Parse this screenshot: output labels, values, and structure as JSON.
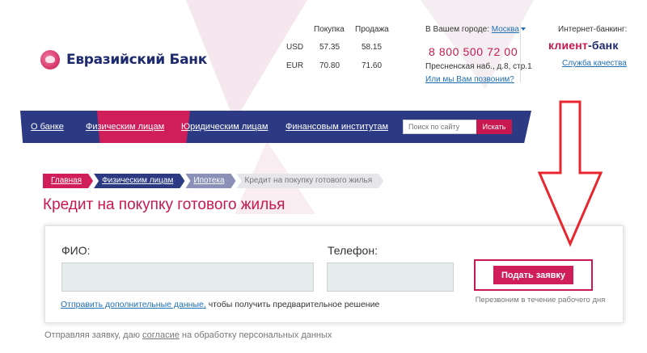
{
  "logo": {
    "name": "Евразийский Банк"
  },
  "rates": {
    "buy_header": "Покупка",
    "sell_header": "Продажа",
    "rows": [
      {
        "currency": "USD",
        "buy": "57.35",
        "sell": "58.15"
      },
      {
        "currency": "EUR",
        "buy": "70.80",
        "sell": "71.60"
      }
    ]
  },
  "contacts": {
    "city_label": "В Вашем городе:",
    "city_value": "Москва",
    "phone": "8 800 500 72 00",
    "address": "Пресненская наб., д.8, стр.1",
    "callback_link": "Или мы Вам позвоним?"
  },
  "internet_banking": {
    "title": "Интернет-банкинг:",
    "brand_part1": "клиент",
    "brand_part2": "-банк",
    "quality_link": "Служба качества"
  },
  "nav": {
    "items": [
      "О банке",
      "Физическим лицам",
      "Юридическим лицам",
      "Финансовым институтам"
    ],
    "active_index": 1,
    "search_placeholder": "Поиск по сайту",
    "search_button": "Искать"
  },
  "breadcrumb": [
    "Главная",
    "Физическим лицам",
    "Ипотека",
    "Кредит на покупку готового жилья"
  ],
  "page_title": "Кредит на покупку готового жилья",
  "form": {
    "name_label": "ФИО:",
    "name_value": "",
    "phone_label": "Телефон:",
    "phone_value": "",
    "submit_label": "Подать заявку",
    "callback_note": "Перезвоним в течение рабочего дня",
    "extra_link": "Отправить дополнительные данные,",
    "extra_text": " чтобы получить предварительное решение"
  },
  "consent": {
    "prefix": "Отправляя заявку, даю ",
    "link": "согласие",
    "suffix": " на обработку персональных данных"
  },
  "annotation": {
    "arrow_color": "#e8262d"
  },
  "colors": {
    "brand_pink": "#c8184f",
    "brand_navy": "#2b3a82",
    "link_blue": "#1f6fb2"
  }
}
